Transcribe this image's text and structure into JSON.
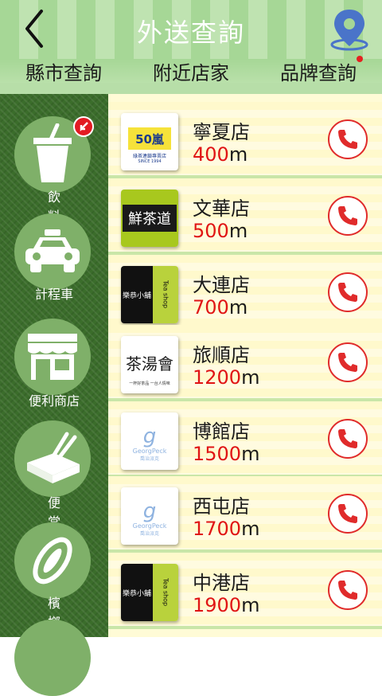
{
  "header": {
    "title": "外送查詢",
    "back_icon": "chevron-left-icon",
    "map_icon": "map-pin-icon"
  },
  "tabs": [
    {
      "label": "縣市查詢"
    },
    {
      "label": "附近店家"
    },
    {
      "label": "品牌查詢",
      "has_dot": true
    }
  ],
  "sidebar": {
    "items": [
      {
        "label": "飲料",
        "icon": "drink-cup-icon",
        "badge_icon": "pointer-badge-icon"
      },
      {
        "label": "計程車",
        "icon": "taxi-icon"
      },
      {
        "label": "便利商店",
        "icon": "storefront-icon"
      },
      {
        "label": "便當",
        "icon": "bento-icon"
      },
      {
        "label": "檳榔",
        "icon": "betel-nut-icon"
      }
    ]
  },
  "stores": [
    {
      "name": "寧夏店",
      "distance": "400",
      "unit": "m",
      "logo": "50嵐",
      "logo_sub": "綠茶連鎖專賣店",
      "logo_since": "SINCE 1994"
    },
    {
      "name": "文華店",
      "distance": "500",
      "unit": "m",
      "logo": "鮮茶道"
    },
    {
      "name": "大連店",
      "distance": "700",
      "unit": "m",
      "logo": "樂恭小舖",
      "logo_side": "Tea shop"
    },
    {
      "name": "旅順店",
      "distance": "1200",
      "unit": "m",
      "logo": "茶湯會",
      "logo_sub": "一杯好茶品 一台人情味"
    },
    {
      "name": "博館店",
      "distance": "1500",
      "unit": "m",
      "logo": "GeorgPeck",
      "logo_sub": "喬治派克"
    },
    {
      "name": "西屯店",
      "distance": "1700",
      "unit": "m",
      "logo": "GeorgPeck",
      "logo_sub": "喬治派克"
    },
    {
      "name": "中港店",
      "distance": "1900",
      "unit": "m",
      "logo": "樂恭小舖",
      "logo_side": "Tea shop"
    }
  ],
  "colors": {
    "accent_red": "#e01515",
    "header_green": "#a6d796",
    "sidebar_green": "#3b6d2b",
    "circle_green": "#7fb069"
  }
}
